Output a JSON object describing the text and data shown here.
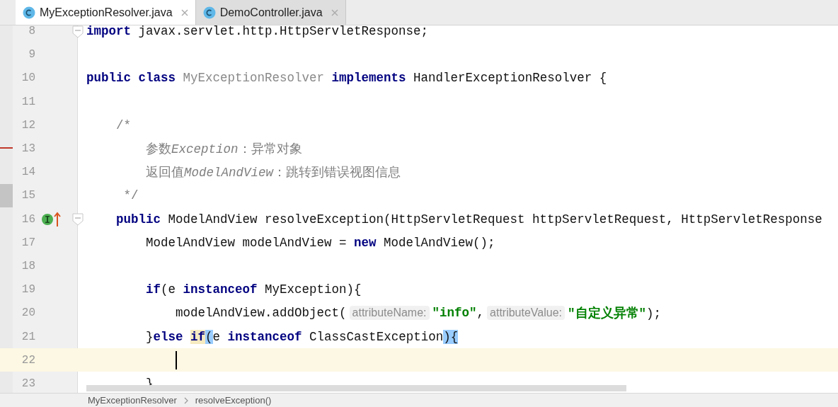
{
  "tabs": [
    {
      "label": "MyExceptionResolver.java",
      "selected": true
    },
    {
      "label": "DemoController.java",
      "selected": false
    }
  ],
  "editor": {
    "lines": [
      {
        "number": "8",
        "fold_start": true,
        "tokens": [
          {
            "text": "import",
            "kind": "keyword"
          },
          {
            "text": " javax.servlet.http.HttpServletResponse;",
            "kind": "plain"
          }
        ]
      },
      {
        "number": "9"
      },
      {
        "number": "10",
        "tokens": [
          {
            "text": "public class ",
            "kind": "keyword"
          },
          {
            "text": "MyExceptionResolver",
            "kind": "dim"
          },
          {
            "text": " implements",
            "kind": "keyword"
          },
          {
            "text": " HandlerExceptionResolver {",
            "kind": "plain"
          }
        ]
      },
      {
        "number": "11"
      },
      {
        "number": "12",
        "tokens": [
          {
            "text": "    /*",
            "kind": "comment"
          }
        ]
      },
      {
        "number": "13",
        "margin_change": true,
        "tokens": [
          {
            "text": "        参数",
            "kind": "comment"
          },
          {
            "text": "Exception",
            "kind": "comment-italic"
          },
          {
            "text": "：异常对象",
            "kind": "comment"
          }
        ]
      },
      {
        "number": "14",
        "tokens": [
          {
            "text": "        返回值",
            "kind": "comment"
          },
          {
            "text": "ModelAndView",
            "kind": "comment-italic"
          },
          {
            "text": "：跳转到错误视图信息",
            "kind": "comment"
          }
        ]
      },
      {
        "number": "15",
        "margin_block": true,
        "tokens": [
          {
            "text": "     */",
            "kind": "comment"
          }
        ]
      },
      {
        "number": "16",
        "fold_start": true,
        "implements_marker": true,
        "tokens": [
          {
            "text": "    public",
            "kind": "keyword"
          },
          {
            "text": " ModelAndView resolveException(HttpServletRequest httpServletRequest, HttpServletResponse",
            "kind": "plain"
          }
        ]
      },
      {
        "number": "17",
        "tokens": [
          {
            "text": "        ModelAndView modelAndView = ",
            "kind": "plain"
          },
          {
            "text": "new",
            "kind": "keyword"
          },
          {
            "text": " ModelAndView();",
            "kind": "plain"
          }
        ]
      },
      {
        "number": "18"
      },
      {
        "number": "19",
        "tokens": [
          {
            "text": "        if",
            "kind": "keyword"
          },
          {
            "text": "(e ",
            "kind": "plain"
          },
          {
            "text": "instanceof",
            "kind": "keyword"
          },
          {
            "text": " MyException){",
            "kind": "plain"
          }
        ]
      },
      {
        "number": "20",
        "tokens": [
          {
            "text": "            modelAndView.addObject(",
            "kind": "plain"
          },
          {
            "text": "attributeName:",
            "kind": "hint"
          },
          {
            "text": "\"info\"",
            "kind": "string"
          },
          {
            "text": ",",
            "kind": "plain"
          },
          {
            "text": "attributeValue:",
            "kind": "hint"
          },
          {
            "text": "\"自定义异常\"",
            "kind": "string"
          },
          {
            "text": ");",
            "kind": "plain"
          }
        ]
      },
      {
        "number": "21",
        "tokens": [
          {
            "text": "        }",
            "kind": "plain"
          },
          {
            "text": "else ",
            "kind": "keyword"
          },
          {
            "text": "if",
            "kind": "keyword",
            "usage_highlight": true
          },
          {
            "text": "(",
            "kind": "plain",
            "brace_match": true
          },
          {
            "text": "e ",
            "kind": "plain"
          },
          {
            "text": "instanceof",
            "kind": "keyword"
          },
          {
            "text": " ClassCastException",
            "kind": "plain"
          },
          {
            "text": ")",
            "kind": "plain",
            "brace_match": true
          },
          {
            "text": "{",
            "kind": "plain",
            "brace_match": true
          }
        ]
      },
      {
        "number": "22",
        "current": true
      },
      {
        "number": "23",
        "tokens": [
          {
            "text": "        }",
            "kind": "plain"
          }
        ]
      }
    ]
  },
  "breadcrumbs": [
    "MyExceptionResolver",
    "resolveException()"
  ]
}
